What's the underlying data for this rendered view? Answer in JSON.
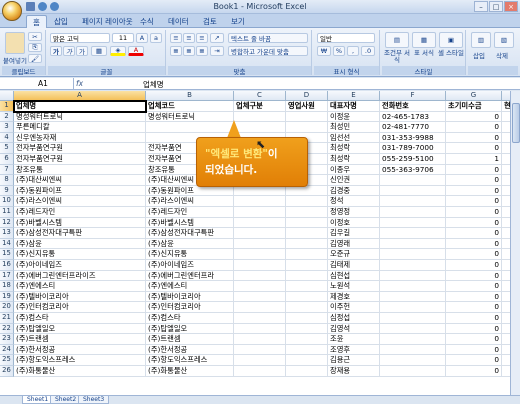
{
  "window": {
    "title": "Book1 - Microsoft Excel",
    "controls": [
      "–",
      "□",
      "×"
    ]
  },
  "tabs": [
    "홈",
    "삽입",
    "페이지 레이아웃",
    "수식",
    "데이터",
    "검토",
    "보기"
  ],
  "ribbon": {
    "clipboard": {
      "label": "클립보드",
      "paste": "붙여넣기"
    },
    "font": {
      "label": "글꼴",
      "name": "맑은 고딕",
      "size": "11",
      "bold": "가",
      "italic": "가",
      "underline": "가"
    },
    "align": {
      "label": "맞춤",
      "wrap": "텍스트 줄 바꿈",
      "merge": "병합하고 가운데 맞춤"
    },
    "number": {
      "label": "표시 형식",
      "format": "일반",
      "percent": "%",
      "comma": ","
    },
    "styles": {
      "label": "스타일",
      "cond": "조건부 서식",
      "table": "표 서식",
      "cell": "셀 스타일"
    },
    "cells": {
      "insert": "삽입",
      "delete": "삭제"
    }
  },
  "formula_bar": {
    "name_box": "A1",
    "fx": "fx",
    "content": "업체명"
  },
  "columns": [
    "A",
    "B",
    "C",
    "D",
    "E",
    "F",
    "G",
    "H"
  ],
  "header_row": [
    "업체명",
    "업체코드",
    "업체구분",
    "영업사원",
    "대표자명",
    "전화번호",
    "초기미수금",
    "현재미수금"
  ],
  "rows": [
    [
      "명성워터트로닉",
      "명성워터트로닉",
      "",
      "",
      "이정윤",
      "02-465-1783",
      "0",
      ""
    ],
    [
      "푸른메디칼",
      "",
      "",
      "",
      "최성민",
      "02-481-7770",
      "0",
      ""
    ],
    [
      "신우엔농자재",
      "",
      "",
      "",
      "임선선",
      "031-353-9988",
      "0",
      ""
    ],
    [
      "전자부품연구원",
      "전자부품연",
      "",
      "",
      "최성락",
      "031-789-7000",
      "0",
      ""
    ],
    [
      "전자부품연구원",
      "전자부품연",
      "",
      "",
      "최성락",
      "055-259-5100",
      "1",
      ""
    ],
    [
      "창조유통",
      "창조유통",
      "",
      "",
      "이종우",
      "055-363-9706",
      "0",
      ""
    ],
    [
      "(주)대산씨엔씨",
      "(주)대산씨엔씨",
      "",
      "",
      "신인권",
      "",
      "0",
      ""
    ],
    [
      "(주)동원파이프",
      "(주)동원파이프",
      "",
      "",
      "김경중",
      "",
      "0",
      ""
    ],
    [
      "(주)라스이엔씨",
      "(주)라스이엔씨",
      "",
      "",
      "정석",
      "",
      "0",
      ""
    ],
    [
      "(주)레드자인",
      "(주)레드자인",
      "",
      "",
      "정영정",
      "",
      "0",
      ""
    ],
    [
      "(주)바벨시스템",
      "(주)바벨시스템",
      "",
      "",
      "이정호",
      "",
      "0",
      ""
    ],
    [
      "(주)삼성전자대구특판",
      "(주)삼성전자대구특판",
      "",
      "",
      "김우길",
      "",
      "0",
      ""
    ],
    [
      "(주)삼윤",
      "(주)삼윤",
      "",
      "",
      "김영래",
      "",
      "0",
      ""
    ],
    [
      "(주)신지유통",
      "(주)신지유통",
      "",
      "",
      "오준규",
      "",
      "0",
      ""
    ],
    [
      "(주)아이네임즈",
      "(주)아이네임즈",
      "",
      "",
      "김태제",
      "",
      "0",
      ""
    ],
    [
      "(주)에버그린엔터프라이즈",
      "(주)에버그린엔터프라",
      "",
      "",
      "심현섭",
      "",
      "0",
      ""
    ],
    [
      "(주)엔에스티",
      "(주)엔에스티",
      "",
      "",
      "노원석",
      "",
      "0",
      ""
    ],
    [
      "(주)텔바이코리아",
      "(주)텔바이코리아",
      "",
      "",
      "제경호",
      "",
      "0",
      ""
    ],
    [
      "(주)인터컴코리아",
      "(주)인터컴코리아",
      "",
      "",
      "이주헌",
      "",
      "0",
      ""
    ],
    [
      "(주)컴스타",
      "(주)컴스타",
      "",
      "",
      "심정섭",
      "",
      "0",
      ""
    ],
    [
      "(주)탑엘일오",
      "(주)탑엘일오",
      "",
      "",
      "김영석",
      "",
      "0",
      ""
    ],
    [
      "(주)트랜셈",
      "(주)트랜셈",
      "",
      "",
      "조윤",
      "",
      "0",
      ""
    ],
    [
      "(주)한서정공",
      "(주)한서정공",
      "",
      "",
      "조영후",
      "",
      "0",
      ""
    ],
    [
      "(주)항도익스프레스",
      "(주)항도익스프레스",
      "",
      "",
      "김용근",
      "",
      "0",
      ""
    ],
    [
      "(주)화통물산",
      "(주)화통물산",
      "",
      "",
      "장재용",
      "",
      "0",
      ""
    ]
  ],
  "sheet_tabs": [
    "Sheet1",
    "Sheet2",
    "Sheet3"
  ],
  "callout": {
    "highlight": "\"엑셀로 변환\"",
    "rest1": "이",
    "rest2": "되었습니다."
  }
}
